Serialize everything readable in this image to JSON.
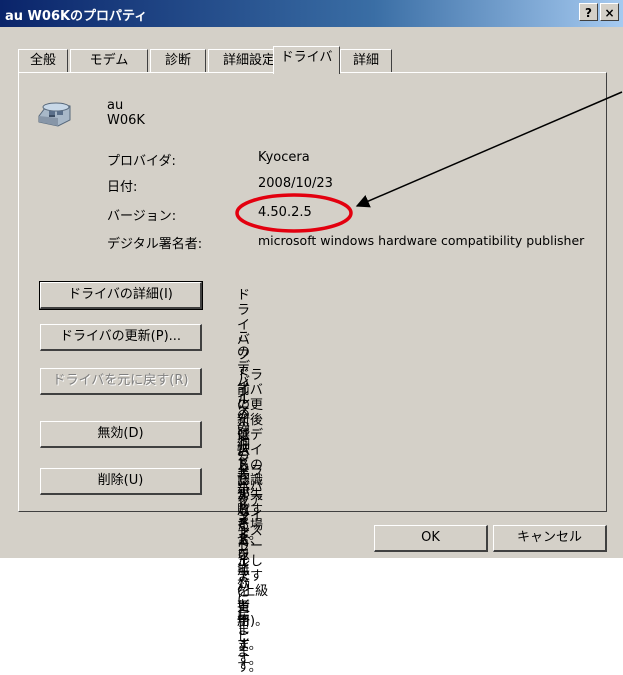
{
  "window": {
    "title": "au W06Kのプロパティ",
    "help_button": "?",
    "close_button": "×"
  },
  "tabs": [
    {
      "label": "全般"
    },
    {
      "label": "モデム"
    },
    {
      "label": "診断"
    },
    {
      "label": "詳細設定"
    },
    {
      "label": "ドライバ",
      "active": true
    },
    {
      "label": "詳細"
    }
  ],
  "device": {
    "name": "au W06K",
    "icon": "modem-phone-icon"
  },
  "info": {
    "provider_label": "プロバイダ:",
    "provider_value": "Kyocera",
    "date_label": "日付:",
    "date_value": "2008/10/23",
    "version_label": "バージョン:",
    "version_value": "4.50.2.5",
    "signer_label": "デジタル署名者:",
    "signer_value": "microsoft windows hardware compatibility publisher"
  },
  "actions": {
    "details_button": "ドライバの詳細(I)",
    "details_desc": "ドライバ ファイルの詳細を表示します。",
    "update_button": "ドライバの更新(P)...",
    "update_desc": "このデバイスのドライバ ソフトウェアを更新します。",
    "rollback_button": "ドライバを元に戻す(R)",
    "rollback_desc_1": "ドライバの更新後にデバイスの認識が失敗する場合、以",
    "rollback_desc_2": "前にインストールしたドライバに戻します。",
    "disable_button": "無効(D)",
    "disable_desc": "選択したデバイスを無効にします。",
    "uninstall_button": "削除(U)",
    "uninstall_desc": "ドライバをアンインストールします (上級者用)。"
  },
  "footer": {
    "ok_label": "OK",
    "cancel_label": "キャンセル"
  },
  "annotation": {
    "highlight_color": "#e3000f",
    "arrow_color": "#000000"
  }
}
